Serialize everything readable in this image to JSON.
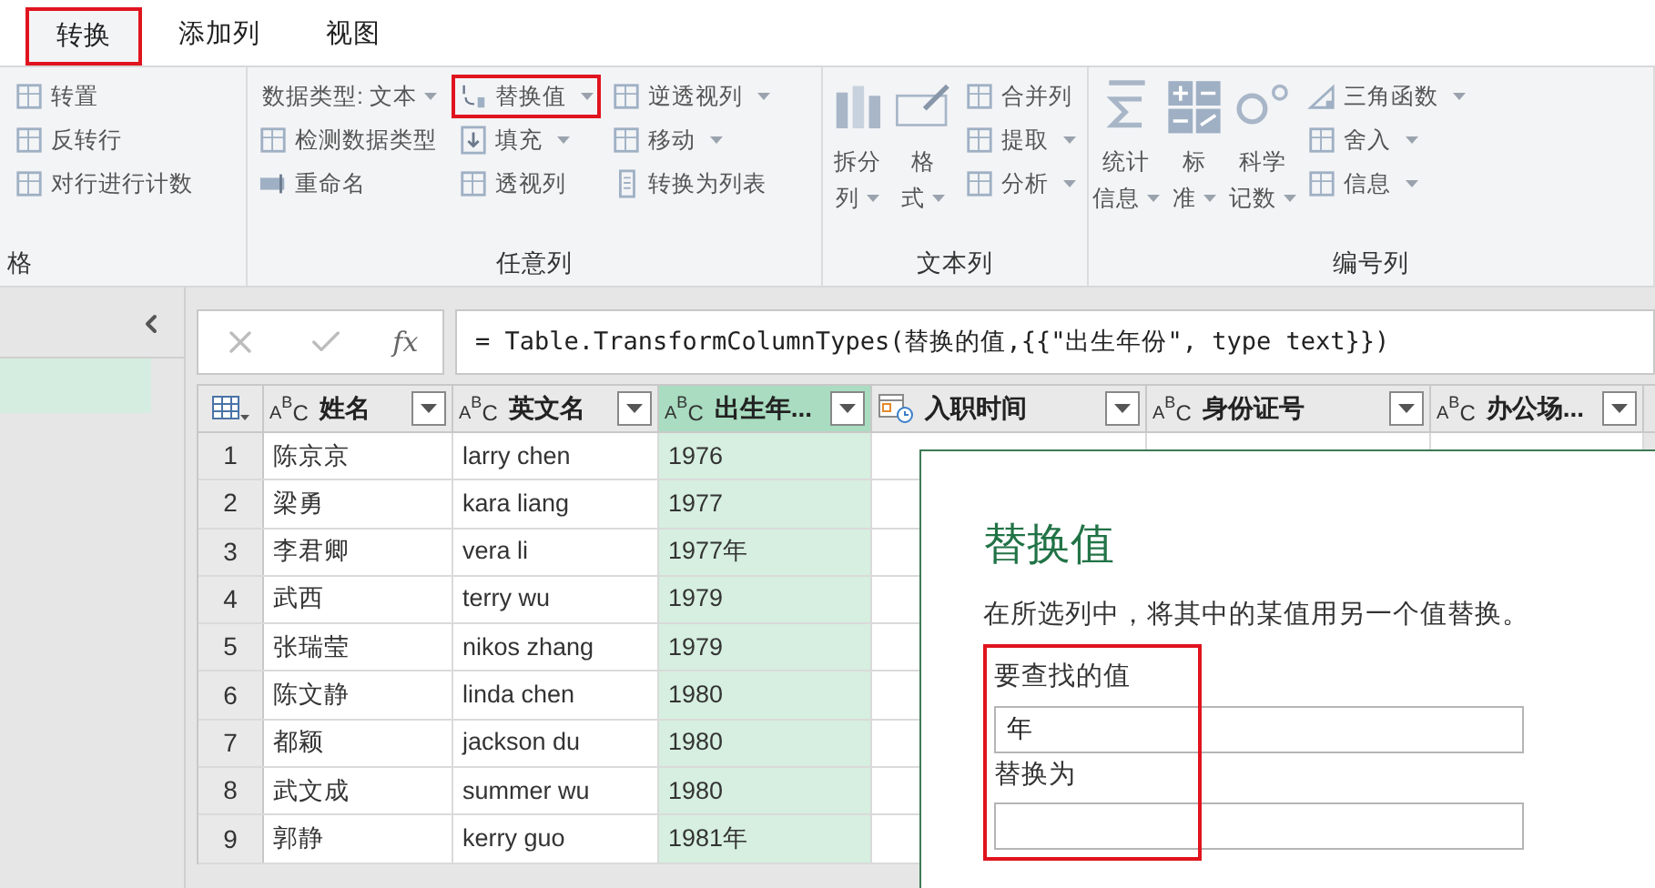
{
  "tabs": [
    {
      "label": "转换",
      "selected": true,
      "highlighted": true
    },
    {
      "label": "添加列",
      "selected": false,
      "highlighted": false
    },
    {
      "label": "视图",
      "selected": false,
      "highlighted": false
    }
  ],
  "ribbon": {
    "groups": [
      {
        "label": "格",
        "columns": [
          [
            {
              "kind": "small",
              "label": "转置",
              "dropdown": false,
              "highlighted": false
            },
            {
              "kind": "small",
              "label": "反转行",
              "dropdown": false,
              "highlighted": false
            },
            {
              "kind": "small",
              "label": "对行进行计数",
              "dropdown": false,
              "highlighted": false
            }
          ]
        ]
      },
      {
        "label": "任意列",
        "columns": [
          [
            {
              "kind": "text",
              "label": "数据类型: 文本",
              "dropdown": true,
              "highlighted": false
            },
            {
              "kind": "small",
              "label": "检测数据类型",
              "dropdown": false,
              "highlighted": false
            },
            {
              "kind": "small",
              "label": "重命名",
              "dropdown": false,
              "highlighted": false
            }
          ],
          [
            {
              "kind": "small",
              "label": "替换值",
              "dropdown": true,
              "highlighted": true
            },
            {
              "kind": "small",
              "label": "填充",
              "dropdown": true,
              "highlighted": false
            },
            {
              "kind": "small",
              "label": "透视列",
              "dropdown": false,
              "highlighted": false
            }
          ],
          [
            {
              "kind": "small",
              "label": "逆透视列",
              "dropdown": true,
              "highlighted": false
            },
            {
              "kind": "small",
              "label": "移动",
              "dropdown": true,
              "highlighted": false
            },
            {
              "kind": "small",
              "label": "转换为列表",
              "dropdown": false,
              "highlighted": false
            }
          ]
        ]
      },
      {
        "label": "文本列",
        "columns": [
          [
            {
              "kind": "large",
              "lines": [
                "拆分",
                "列"
              ],
              "dropdown": true
            }
          ],
          [
            {
              "kind": "large",
              "lines": [
                "格",
                "式"
              ],
              "dropdown": true
            }
          ],
          [
            {
              "kind": "small",
              "label": "合并列",
              "dropdown": false,
              "highlighted": false
            },
            {
              "kind": "small",
              "label": "提取",
              "dropdown": true,
              "highlighted": false
            },
            {
              "kind": "small",
              "label": "分析",
              "dropdown": true,
              "highlighted": false
            }
          ]
        ]
      },
      {
        "label": "编号列",
        "columns": [
          [
            {
              "kind": "large",
              "lines": [
                "统计",
                "信息"
              ],
              "dropdown": true
            }
          ],
          [
            {
              "kind": "large",
              "lines": [
                "标",
                "准"
              ],
              "dropdown": true
            }
          ],
          [
            {
              "kind": "large",
              "lines": [
                "科学",
                "记数"
              ],
              "dropdown": true
            }
          ],
          [
            {
              "kind": "small",
              "label": "三角函数",
              "dropdown": true,
              "highlighted": false
            },
            {
              "kind": "small",
              "label": "舍入",
              "dropdown": true,
              "highlighted": false
            },
            {
              "kind": "small",
              "label": "信息",
              "dropdown": true,
              "highlighted": false
            }
          ]
        ]
      }
    ]
  },
  "formula_bar": {
    "fx": "fx",
    "formula": "= Table.TransformColumnTypes(替换的值,{{\"出生年份\", type text}})"
  },
  "table": {
    "columns": [
      {
        "label": "姓名",
        "kind": "text",
        "type_label": "ABC",
        "selected": false
      },
      {
        "label": "英文名",
        "kind": "text",
        "type_label": "ABC",
        "selected": false
      },
      {
        "label": "出生年...",
        "kind": "text",
        "type_label": "ABC",
        "selected": true
      },
      {
        "label": "入职时间",
        "kind": "datetime",
        "selected": false
      },
      {
        "label": "身份证号",
        "kind": "text",
        "type_label": "ABC",
        "selected": false
      },
      {
        "label": "办公场...",
        "kind": "text",
        "type_label": "ABC",
        "selected": false
      }
    ],
    "rows": [
      {
        "index": "1",
        "cells": [
          "陈京京",
          "larry chen",
          "1976"
        ]
      },
      {
        "index": "2",
        "cells": [
          "梁勇",
          "kara liang",
          "1977"
        ]
      },
      {
        "index": "3",
        "cells": [
          "李君卿",
          "vera li",
          "1977年"
        ]
      },
      {
        "index": "4",
        "cells": [
          "武西",
          "terry wu",
          "1979"
        ]
      },
      {
        "index": "5",
        "cells": [
          "张瑞莹",
          "nikos zhang",
          "1979"
        ]
      },
      {
        "index": "6",
        "cells": [
          "陈文静",
          "linda chen",
          "1980"
        ]
      },
      {
        "index": "7",
        "cells": [
          "都颖",
          "jackson du",
          "1980"
        ]
      },
      {
        "index": "8",
        "cells": [
          "武文成",
          "summer wu",
          "1980"
        ]
      },
      {
        "index": "9",
        "cells": [
          "郭静",
          "kerry guo",
          "1981年"
        ]
      }
    ]
  },
  "dialog": {
    "title": "替换值",
    "description": "在所选列中，将其中的某值用另一个值替换。",
    "fields": [
      {
        "label": "要查找的值",
        "value": "年",
        "highlighted": true
      },
      {
        "label": "替换为",
        "highlighted": true
      }
    ]
  }
}
